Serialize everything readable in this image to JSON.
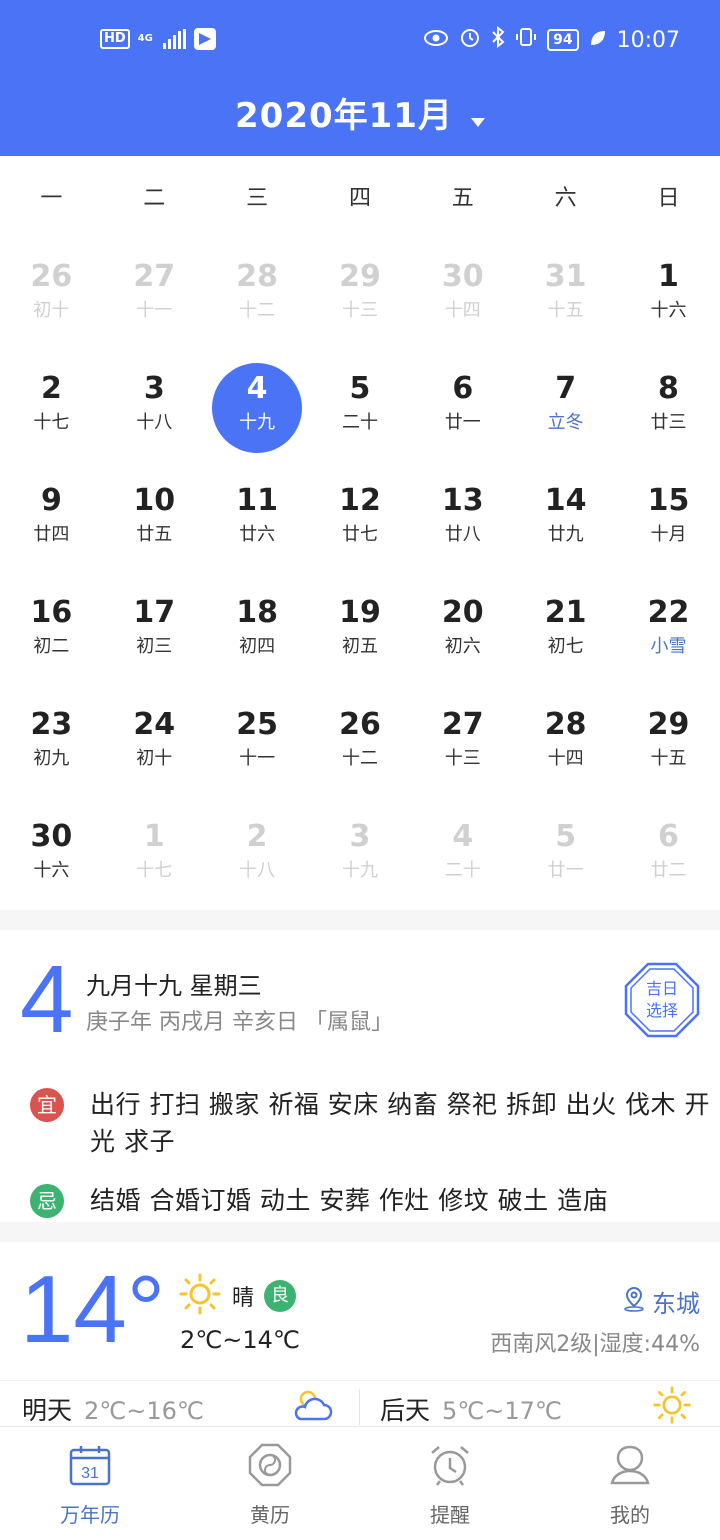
{
  "status_bar": {
    "hd": "HD",
    "net": "4G",
    "time": "10:07",
    "battery": "94"
  },
  "header": {
    "title": "2020年11月"
  },
  "weekdays": [
    "一",
    "二",
    "三",
    "四",
    "五",
    "六",
    "日"
  ],
  "calendar": {
    "rows": [
      [
        {
          "day": "26",
          "lunar": "初十",
          "other": true
        },
        {
          "day": "27",
          "lunar": "十一",
          "other": true
        },
        {
          "day": "28",
          "lunar": "十二",
          "other": true
        },
        {
          "day": "29",
          "lunar": "十三",
          "other": true
        },
        {
          "day": "30",
          "lunar": "十四",
          "other": true
        },
        {
          "day": "31",
          "lunar": "十五",
          "other": true
        },
        {
          "day": "1",
          "lunar": "十六"
        }
      ],
      [
        {
          "day": "2",
          "lunar": "十七"
        },
        {
          "day": "3",
          "lunar": "十八"
        },
        {
          "day": "4",
          "lunar": "十九",
          "today": true
        },
        {
          "day": "5",
          "lunar": "二十"
        },
        {
          "day": "6",
          "lunar": "廿一"
        },
        {
          "day": "7",
          "lunar": "立冬",
          "term": true
        },
        {
          "day": "8",
          "lunar": "廿三"
        }
      ],
      [
        {
          "day": "9",
          "lunar": "廿四"
        },
        {
          "day": "10",
          "lunar": "廿五"
        },
        {
          "day": "11",
          "lunar": "廿六"
        },
        {
          "day": "12",
          "lunar": "廿七"
        },
        {
          "day": "13",
          "lunar": "廿八"
        },
        {
          "day": "14",
          "lunar": "廿九"
        },
        {
          "day": "15",
          "lunar": "十月"
        }
      ],
      [
        {
          "day": "16",
          "lunar": "初二"
        },
        {
          "day": "17",
          "lunar": "初三"
        },
        {
          "day": "18",
          "lunar": "初四"
        },
        {
          "day": "19",
          "lunar": "初五"
        },
        {
          "day": "20",
          "lunar": "初六"
        },
        {
          "day": "21",
          "lunar": "初七"
        },
        {
          "day": "22",
          "lunar": "小雪",
          "term": true
        }
      ],
      [
        {
          "day": "23",
          "lunar": "初九"
        },
        {
          "day": "24",
          "lunar": "初十"
        },
        {
          "day": "25",
          "lunar": "十一"
        },
        {
          "day": "26",
          "lunar": "十二"
        },
        {
          "day": "27",
          "lunar": "十三"
        },
        {
          "day": "28",
          "lunar": "十四"
        },
        {
          "day": "29",
          "lunar": "十五"
        }
      ],
      [
        {
          "day": "30",
          "lunar": "十六"
        },
        {
          "day": "1",
          "lunar": "十七",
          "other": true
        },
        {
          "day": "2",
          "lunar": "十八",
          "other": true
        },
        {
          "day": "3",
          "lunar": "十九",
          "other": true
        },
        {
          "day": "4",
          "lunar": "二十",
          "other": true
        },
        {
          "day": "5",
          "lunar": "廿一",
          "other": true
        },
        {
          "day": "6",
          "lunar": "廿二",
          "other": true
        }
      ]
    ]
  },
  "detail": {
    "day": "4",
    "lunar_date": "九月十九  星期三",
    "ganzhi": "庚子年 丙戌月 辛亥日 「属鼠」",
    "jiri_line1": "吉日",
    "jiri_line2": "选择",
    "yi_label": "宜",
    "yi_text": "出行 打扫 搬家 祈福 安床 纳畜 祭祀 拆卸 出火 伐木 开光 求子",
    "ji_label": "忌",
    "ji_text": "结婚 合婚订婚 动土 安葬 作灶 修坟 破土 造庙"
  },
  "weather": {
    "temp": "14°",
    "condition": "晴",
    "air_quality": "良",
    "range": "2℃~14℃",
    "location": "东城",
    "wind": "西南风2级|湿度:44%",
    "tomorrow_label": "明天",
    "tomorrow_range": "2℃~16℃",
    "after_label": "后天",
    "after_range": "5℃~17℃"
  },
  "nav": {
    "tabs": [
      {
        "label": "万年历",
        "icon": "calendar-icon",
        "active": true,
        "iconText": "31"
      },
      {
        "label": "黄历",
        "icon": "bagua-icon"
      },
      {
        "label": "提醒",
        "icon": "alarm-clock-icon"
      },
      {
        "label": "我的",
        "icon": "user-icon"
      }
    ]
  },
  "colors": {
    "brand": "#4b73f5",
    "term": "#4b73c8",
    "yi": "#d9534f",
    "ji": "#3cb371"
  }
}
